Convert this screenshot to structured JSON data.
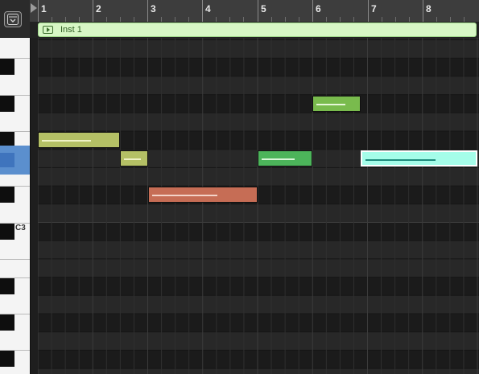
{
  "toolbar": {
    "menu_icon": "chevron-down-icon"
  },
  "ruler": {
    "bars": [
      "1",
      "2",
      "3",
      "4",
      "5",
      "6",
      "7",
      "8"
    ]
  },
  "region": {
    "name": "Inst 1",
    "icon": "play-icon",
    "color": "#d7f7c5"
  },
  "keyboard": {
    "label_c3": "C3",
    "highlight_color": "#5b8fce"
  },
  "notes": [
    {
      "id": "note-1",
      "start": 1.0,
      "end": 2.5,
      "row": 5,
      "color": "#b4c065",
      "velocity_color": "#eef1c4",
      "selected": false
    },
    {
      "id": "note-2",
      "start": 2.5,
      "end": 3.0,
      "row": 6,
      "color": "#b4c065",
      "velocity_color": "#eef1c4",
      "selected": false
    },
    {
      "id": "note-3",
      "start": 3.0,
      "end": 5.0,
      "row": 8,
      "color": "#c66d55",
      "velocity_color": "#f3d3c8",
      "selected": false
    },
    {
      "id": "note-4",
      "start": 5.0,
      "end": 6.0,
      "row": 6,
      "color": "#4cb45a",
      "velocity_color": "#d6f6d6",
      "selected": false
    },
    {
      "id": "note-5",
      "start": 6.0,
      "end": 6.875,
      "row": 3,
      "color": "#79bb4d",
      "velocity_color": "#e6f7d8",
      "selected": false
    },
    {
      "id": "note-6",
      "start": 6.875,
      "end": 9.0,
      "row": 6,
      "color": "#a5fde9",
      "velocity_color": "#1d8c7c",
      "selected": true
    }
  ]
}
